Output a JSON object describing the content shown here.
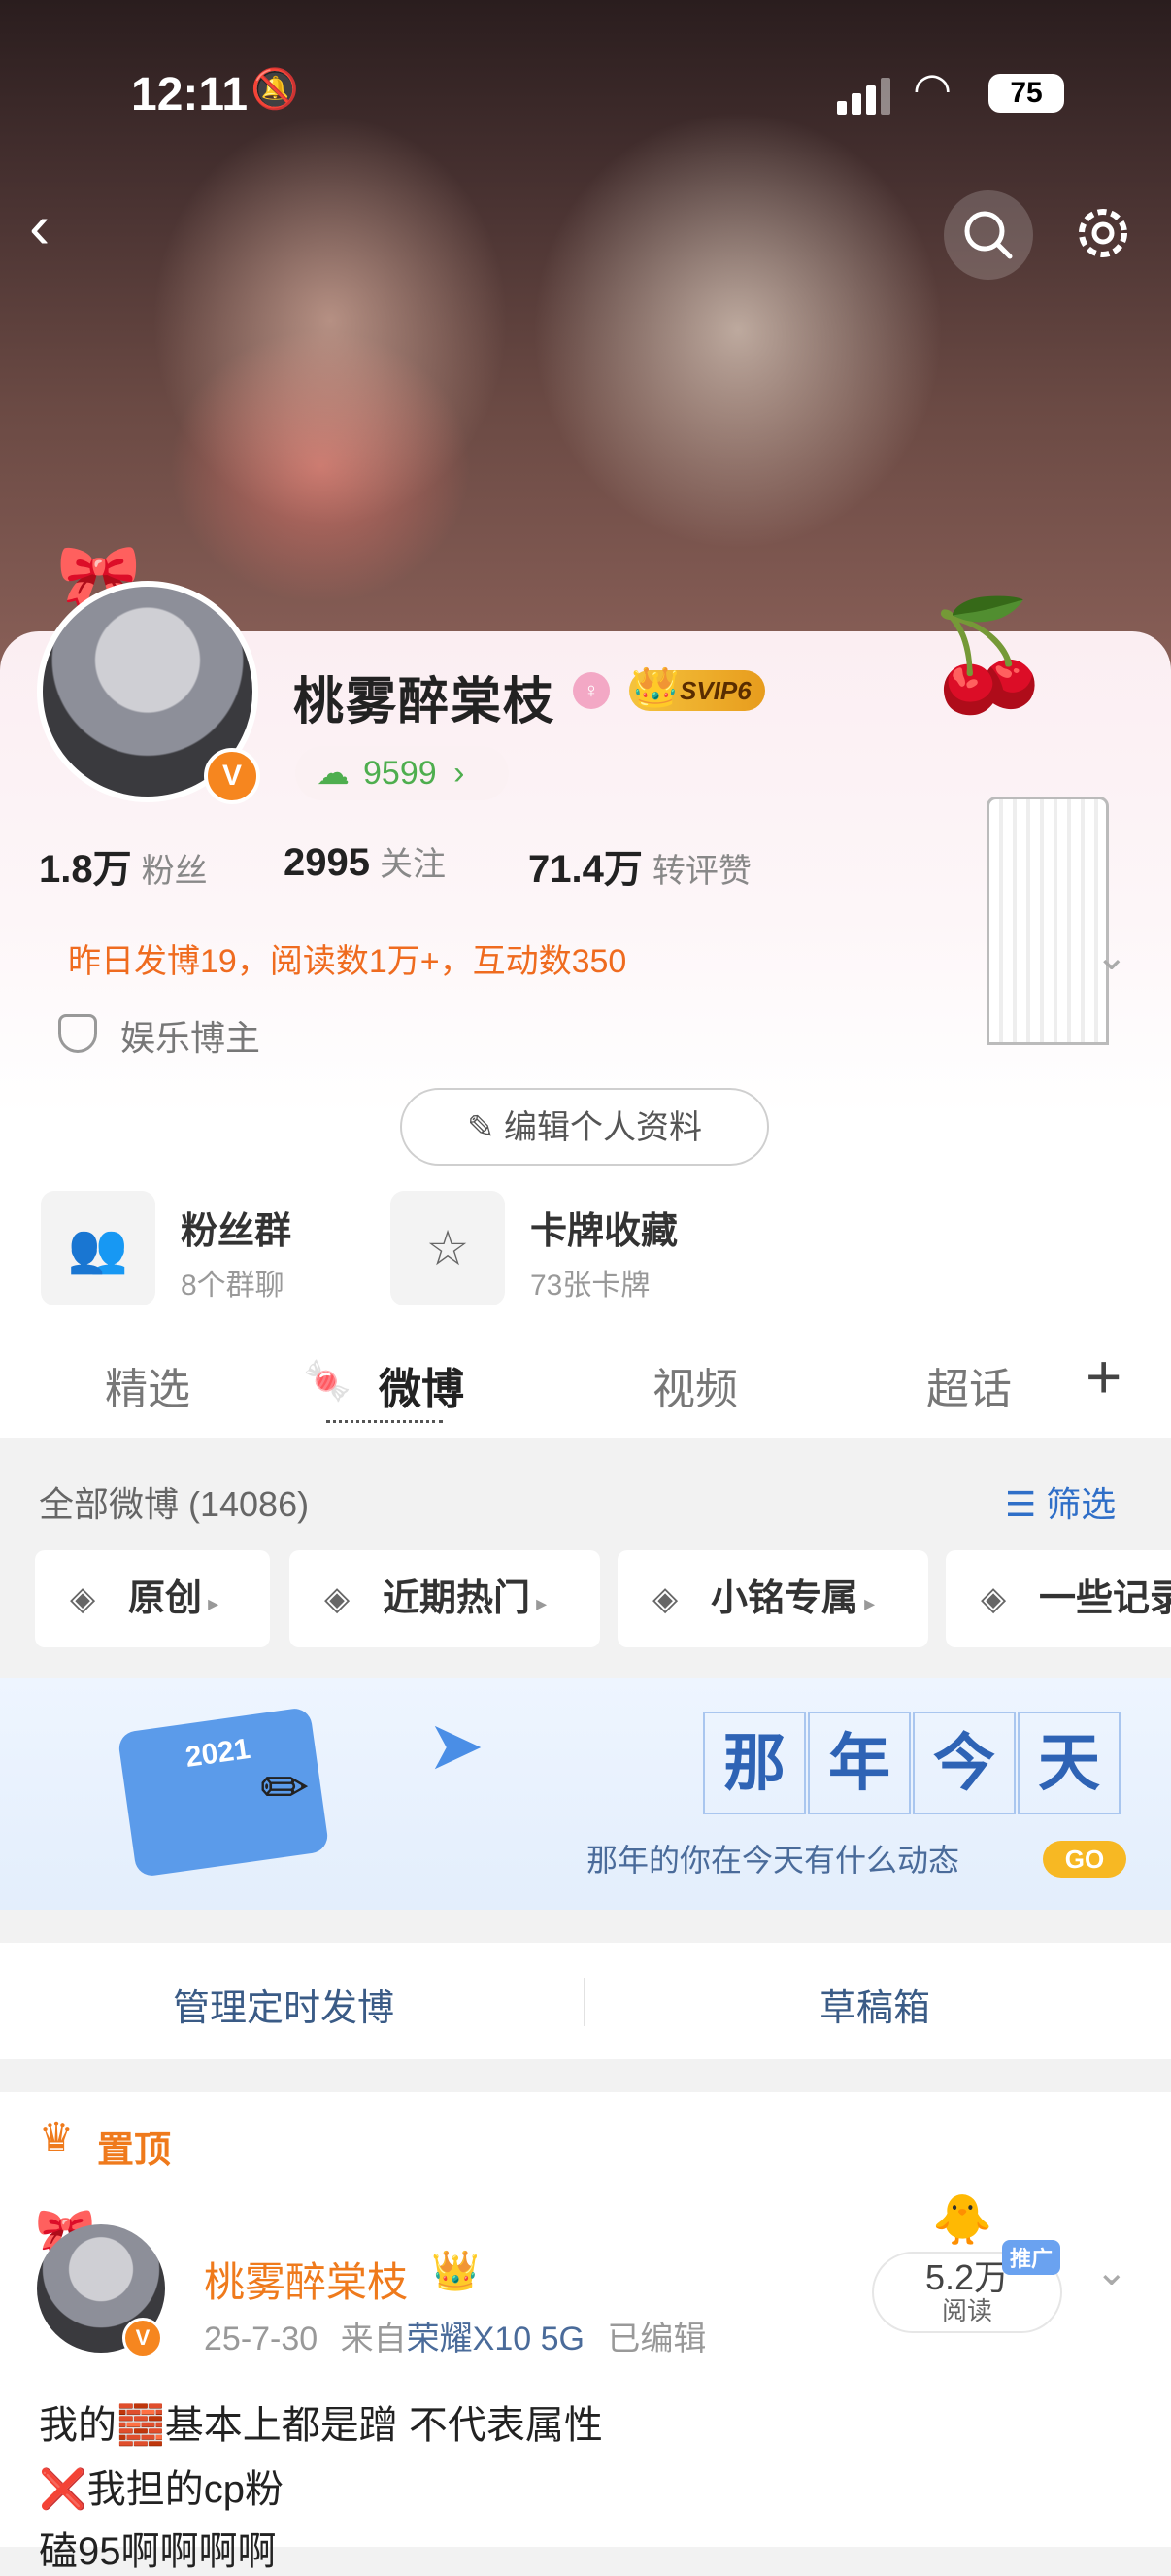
{
  "status_bar": {
    "time": "12:11",
    "battery": "75"
  },
  "profile": {
    "name": "桃雾醉棠枝",
    "vip_badge": "SVIP6",
    "green_count": "9599",
    "green_arrow": "›",
    "verified_badge": "V",
    "stats": [
      {
        "value": "1.8万",
        "label": "粉丝"
      },
      {
        "value": "2995",
        "label": "关注"
      },
      {
        "value": "71.4万",
        "label": "转评赞"
      }
    ],
    "activity_notice": "昨日发博19，阅读数1万+，互动数350",
    "role": "娱乐博主",
    "edit_button": "编辑个人资料"
  },
  "tiles": [
    {
      "title": "粉丝群",
      "subtitle": "8个群聊"
    },
    {
      "title": "卡牌收藏",
      "subtitle": "73张卡牌"
    }
  ],
  "tabs": [
    "精选",
    "微博",
    "视频",
    "超话"
  ],
  "active_tab": "微博",
  "feed": {
    "all_label": "全部微博 (14086)",
    "filter_label": "筛选",
    "chips": [
      "原创",
      "近期热门",
      "小铭专属",
      "一些记录"
    ]
  },
  "banner": {
    "title_chars": [
      "那",
      "年",
      "今",
      "天"
    ],
    "subtitle": "那年的你在今天有什么动态",
    "go": "GO",
    "calendar_year": "2021"
  },
  "actions": {
    "scheduled": "管理定时发博",
    "drafts": "草稿箱"
  },
  "post": {
    "pinned_label": "置顶",
    "author": "桃雾醉棠枝",
    "verified_badge": "V",
    "date": "25-7-30",
    "source_prefix": "来自",
    "device": "荣耀X10 5G",
    "edited": "已编辑",
    "reads_value": "5.2万",
    "reads_label": "阅读",
    "promo": "推广",
    "lines": [
      "我的🧱基本上都是蹭 不代表属性",
      "❌我担的cp粉",
      "磕95啊啊啊啊"
    ]
  },
  "colors": {
    "accent": "#ef7a1c",
    "link": "#2f6fc8",
    "green": "#4eae4e"
  }
}
